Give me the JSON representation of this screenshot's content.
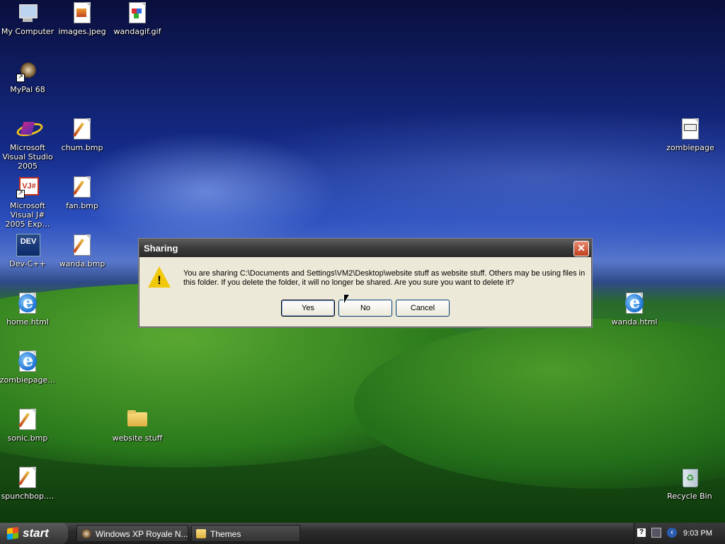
{
  "desktop": {
    "icons": [
      {
        "label": "My Computer",
        "icon": "computer-icon"
      },
      {
        "label": "images.jpeg",
        "icon": "image-file-icon"
      },
      {
        "label": "wandagif.gif",
        "icon": "gif-file-icon"
      },
      {
        "label": "MyPal 68",
        "icon": "mypal-icon"
      },
      {
        "label": "Microsoft Visual Studio 2005",
        "icon": "visual-studio-icon"
      },
      {
        "label": "chum.bmp",
        "icon": "bitmap-file-icon"
      },
      {
        "label": "zombiepage",
        "icon": "web-file-icon"
      },
      {
        "label": "Microsoft Visual J# 2005 Exp…",
        "icon": "vj-icon"
      },
      {
        "label": "fan.bmp",
        "icon": "bitmap-file-icon"
      },
      {
        "label": "Dev-C++",
        "icon": "devcpp-icon"
      },
      {
        "label": "wanda.bmp",
        "icon": "bitmap-file-icon"
      },
      {
        "label": "home.html",
        "icon": "ie-html-icon"
      },
      {
        "label": "wanda.html",
        "icon": "ie-html-icon"
      },
      {
        "label": "zombiepage…",
        "icon": "ie-html-icon"
      },
      {
        "label": "sonic.bmp",
        "icon": "bitmap-file-icon"
      },
      {
        "label": "website stuff",
        "icon": "folder-icon"
      },
      {
        "label": "spunchbop.…",
        "icon": "bitmap-file-icon"
      },
      {
        "label": "Recycle Bin",
        "icon": "recycle-bin-icon"
      }
    ]
  },
  "dialog": {
    "title": "Sharing",
    "close_label": "✕",
    "icon": "warning-icon",
    "message": "You are sharing C:\\Documents and Settings\\VM2\\Desktop\\website stuff as website stuff. Others may be using files in this folder. If you delete the folder, it will no longer be shared. Are you sure you want to delete it?",
    "yes_label": "Yes",
    "no_label": "No",
    "cancel_label": "Cancel"
  },
  "taskbar": {
    "start_label": "start",
    "tasks": [
      {
        "label": "Windows XP Royale N...",
        "icon": "mypal-icon"
      },
      {
        "label": "Themes",
        "icon": "folder-icon"
      }
    ],
    "tray": {
      "clock": "9:03 PM",
      "help_icon": "?",
      "chevron": "‹"
    }
  }
}
